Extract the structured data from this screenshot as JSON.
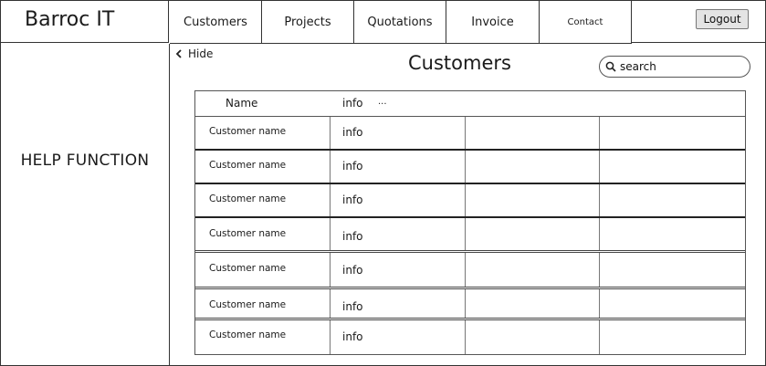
{
  "app": {
    "title": "Barroc IT"
  },
  "nav": {
    "items": [
      {
        "label": "Customers"
      },
      {
        "label": "Projects"
      },
      {
        "label": "Quotations"
      },
      {
        "label": "Invoice"
      },
      {
        "label": "Contact"
      }
    ],
    "logout_label": "Logout"
  },
  "sidebar": {
    "help_label": "HELP FUNCTION"
  },
  "main": {
    "hide_label": "Hide",
    "title": "Customers",
    "search_placeholder": "search"
  },
  "table": {
    "headers": {
      "name": "Name",
      "info": "info",
      "more": "..."
    },
    "rows": [
      {
        "name": "Customer name",
        "info": "info"
      },
      {
        "name": "Customer name",
        "info": "info"
      },
      {
        "name": "Customer name",
        "info": "info"
      },
      {
        "name": "Customer name",
        "info": "info"
      },
      {
        "name": "Customer name",
        "info": "info"
      },
      {
        "name": "Customer name",
        "info": "info"
      },
      {
        "name": "Customer name",
        "info": "info"
      }
    ]
  },
  "icons": {
    "hide": "chevron-left-icon",
    "search": "search-icon"
  }
}
